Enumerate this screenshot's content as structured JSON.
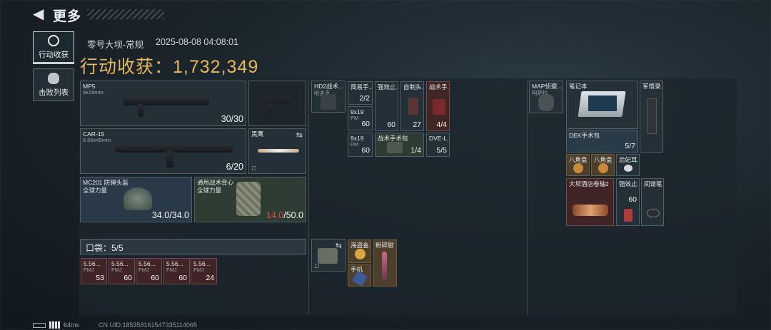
{
  "header": {
    "title": "更多"
  },
  "tabs": [
    {
      "label": "行动收获",
      "active": true
    },
    {
      "label": "击败列表",
      "active": false
    }
  ],
  "raid": {
    "map": "零号大坝-常规",
    "time": "2025-08-08 04:08:01",
    "gain_label": "行动收获：",
    "gain_value": "1,732,349"
  },
  "loadout": {
    "primary1": {
      "name": "MP5",
      "sub": "9x19mm",
      "ammo": "30/30"
    },
    "primary2": {
      "name": "CAR-15",
      "sub": "5.56x45mm",
      "ammo": "6/20"
    },
    "melee": {
      "name": "黑鹰"
    },
    "helmet": {
      "name": "MC201 防弹头盔",
      "sub": "全球力量",
      "current": "34.0",
      "max": "/34.0"
    },
    "armor": {
      "name": "通用战术背心",
      "sub": "全球力量",
      "current": "14.0",
      "max": "/50.0"
    }
  },
  "pocket": {
    "label": "口袋：5/5",
    "items": [
      {
        "name": "5.56...",
        "sub": "FMJ",
        "count": "53"
      },
      {
        "name": "5.56...",
        "sub": "FMJ",
        "count": "60"
      },
      {
        "name": "5.56...",
        "sub": "FMJ",
        "count": "60"
      },
      {
        "name": "5.56...",
        "sub": "FMJ",
        "count": "60"
      },
      {
        "name": "5.56...",
        "sub": "FMJ",
        "count": "24"
      }
    ]
  },
  "rig": {
    "items": [
      {
        "name": "HD2战术...",
        "sub": "哈夫克"
      },
      {
        "name": "简易手...",
        "count": "2/2"
      },
      {
        "name": "强效止...",
        "count": "60"
      },
      {
        "name": "自制头...",
        "count": "27"
      },
      {
        "name": "战术手...",
        "count": "4/4"
      },
      {
        "name": "9x19",
        "sub": "PM",
        "count": "60"
      },
      {
        "name": "强效止...",
        "count": "60"
      },
      {
        "name": "9x19",
        "sub": "PM",
        "count": "60"
      },
      {
        "name": "战术手术包",
        "count": "1/4"
      },
      {
        "name": "DVE-L...",
        "count": "5/5"
      }
    ],
    "pouch": [
      {
        "name": "海盗金..."
      },
      {
        "name": "粉碎钳"
      },
      {
        "name": "手机"
      }
    ]
  },
  "backpack": {
    "items": [
      {
        "name": "MAP侦察...",
        "sub": "阿萨拉"
      },
      {
        "name": "笔记本"
      },
      {
        "name": "军情录..."
      },
      {
        "name": "DEK手术包",
        "count": "5/7"
      },
      {
        "name": "八角盒"
      },
      {
        "name": "八角盒"
      },
      {
        "name": "后妃耳..."
      },
      {
        "name": "大坝酒店卷轴2"
      },
      {
        "name": "强效止...",
        "count": "60"
      },
      {
        "name": "间谍笔"
      }
    ]
  },
  "footer": {
    "ping": "64ms",
    "uid": "CN UID:185358161547335114065"
  },
  "colors": {
    "gain": "#e8b85a",
    "damaged": "#e04a3c",
    "panel": "#1c262d"
  }
}
